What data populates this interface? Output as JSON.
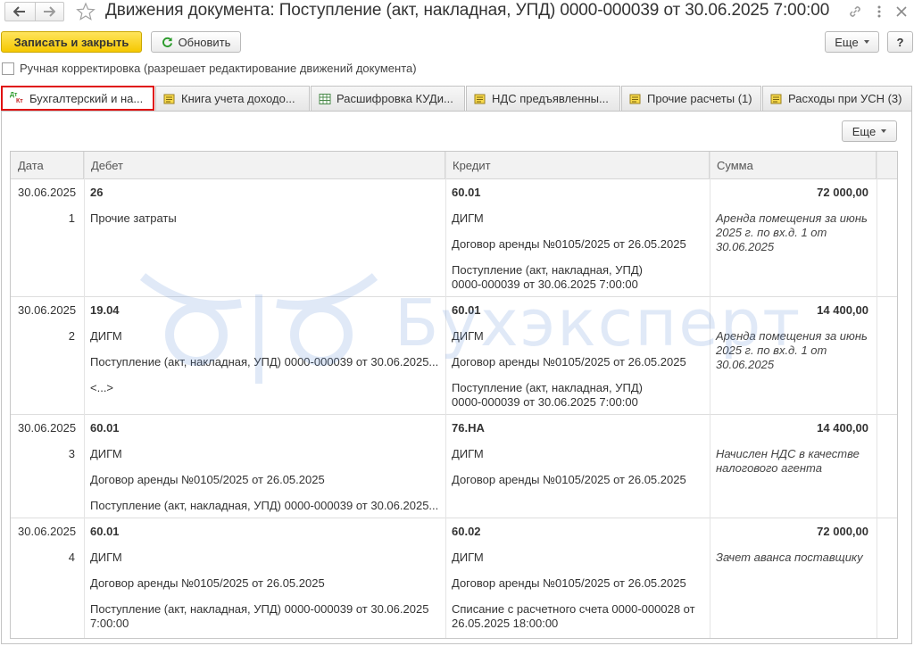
{
  "window": {
    "title": "Движения документа: Поступление (акт, накладная, УПД) 0000-000039 от 30.06.2025 7:00:00",
    "more_icon": "dots-icon",
    "link_icon": "link-icon",
    "close_icon": "close-icon"
  },
  "toolbar": {
    "save_close_label": "Записать и закрыть",
    "refresh_label": "Обновить",
    "more_label": "Еще",
    "help_label": "?"
  },
  "manual_edit": {
    "label": "Ручная корректировка (разрешает редактирование движений документа)",
    "checked": false
  },
  "tabs": [
    {
      "label": "Бухгалтерский и на...",
      "active": true,
      "icon": "dt-kt-icon"
    },
    {
      "label": "Книга учета доходо...",
      "active": false,
      "icon": "register-icon"
    },
    {
      "label": "Расшифровка КУДи...",
      "active": false,
      "icon": "table-icon"
    },
    {
      "label": "НДС предъявленны...",
      "active": false,
      "icon": "register-icon"
    },
    {
      "label": "Прочие расчеты (1)",
      "active": false,
      "icon": "register-icon"
    },
    {
      "label": "Расходы при УСН (3)",
      "active": false,
      "icon": "register-icon"
    }
  ],
  "panel": {
    "more_label": "Еще"
  },
  "table": {
    "columns": [
      "Дата",
      "Дебет",
      "Кредит",
      "Сумма"
    ],
    "rows": [
      {
        "date": "30.06.2025",
        "number": "1",
        "debit": [
          "26",
          "Прочие затраты"
        ],
        "credit": [
          "60.01",
          "ДИГМ",
          "Договор аренды №0105/2025 от 26.05.2025",
          "Поступление (акт, накладная, УПД)\n0000-000039 от 30.06.2025 7:00:00"
        ],
        "amount": "72 000,00",
        "comment": "Аренда помещения за июнь\n2025 г. по вх.д. 1 от\n30.06.2025"
      },
      {
        "date": "30.06.2025",
        "number": "2",
        "debit": [
          "19.04",
          "ДИГМ",
          "Поступление (акт, накладная, УПД) 0000-000039 от 30.06.2025...",
          "<...>"
        ],
        "credit": [
          "60.01",
          "ДИГМ",
          "Договор аренды №0105/2025 от 26.05.2025",
          "Поступление (акт, накладная, УПД)\n0000-000039 от 30.06.2025 7:00:00"
        ],
        "amount": "14 400,00",
        "comment": "Аренда помещения за июнь\n2025 г. по вх.д. 1 от\n30.06.2025"
      },
      {
        "date": "30.06.2025",
        "number": "3",
        "debit": [
          "60.01",
          "ДИГМ",
          "Договор аренды №0105/2025 от 26.05.2025",
          "Поступление (акт, накладная, УПД) 0000-000039 от 30.06.2025..."
        ],
        "credit": [
          "76.НА",
          "ДИГМ",
          "Договор аренды №0105/2025 от 26.05.2025"
        ],
        "amount": "14 400,00",
        "comment": "Начислен НДС в качестве\nналогового агента"
      },
      {
        "date": "30.06.2025",
        "number": "4",
        "debit": [
          "60.01",
          "ДИГМ",
          "Договор аренды №0105/2025 от 26.05.2025",
          "Поступление (акт, накладная, УПД) 0000-000039 от 30.06.2025\n7:00:00"
        ],
        "credit": [
          "60.02",
          "ДИГМ",
          "Договор аренды №0105/2025 от 26.05.2025",
          "Списание с расчетного счета 0000-000028 от\n26.05.2025 18:00:00"
        ],
        "amount": "72 000,00",
        "comment": "Зачет аванса поставщику"
      }
    ]
  },
  "watermark": {
    "text": "Бухэксперт"
  },
  "colors": {
    "accent_yellow": "#f5c800",
    "active_tab_border": "#e01010",
    "refresh_green": "#2a9a2a"
  }
}
